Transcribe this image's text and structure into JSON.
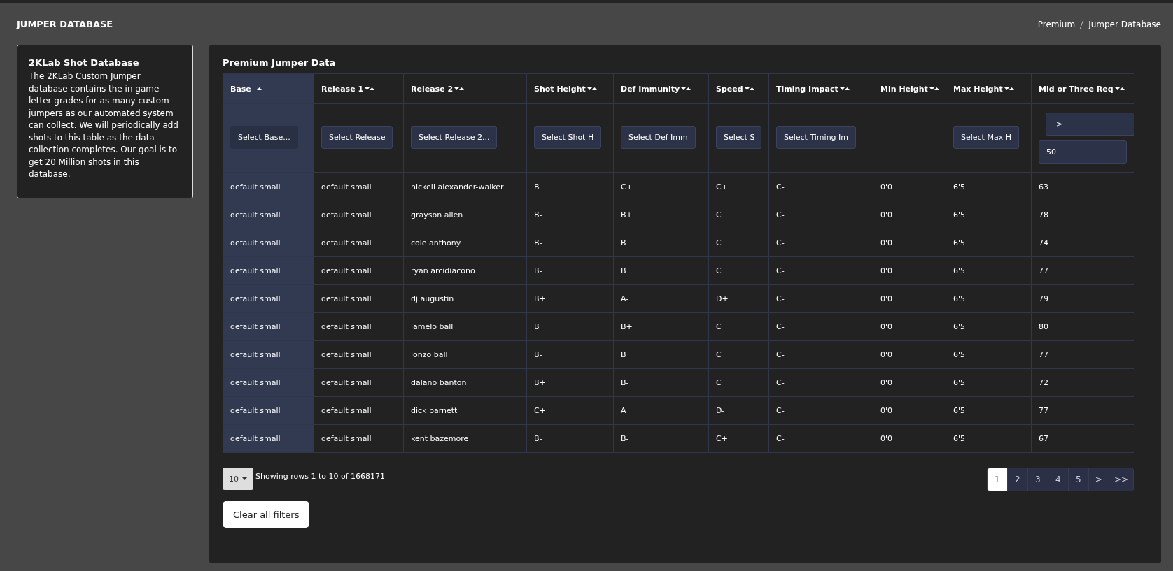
{
  "page_title": "JUMPER DATABASE",
  "breadcrumb": [
    "Premium",
    "Jumper Database"
  ],
  "info_card": {
    "title": "2KLab Shot Database",
    "text": "The 2KLab Custom Jumper database contains the in game letter grades for as many custom jumpers as our automated system can collect. We will periodically add shots to this table as the data collection completes. Our goal is to get 20 Million shots in this database."
  },
  "panel": {
    "title": "Premium Jumper Data"
  },
  "table": {
    "columns": [
      {
        "label": "Base",
        "sorted": true,
        "filter": {
          "kind": "select",
          "placeholder": "Select Base..."
        }
      },
      {
        "label": "Release 1",
        "sorted": false,
        "filter": {
          "kind": "select",
          "placeholder": "Select Release"
        }
      },
      {
        "label": "Release 2",
        "sorted": false,
        "filter": {
          "kind": "select",
          "placeholder": "Select Release 2..."
        }
      },
      {
        "label": "Shot Height",
        "sorted": false,
        "filter": {
          "kind": "select",
          "placeholder": "Select Shot H"
        }
      },
      {
        "label": "Def Immunity",
        "sorted": false,
        "filter": {
          "kind": "select",
          "placeholder": "Select Def Imm"
        }
      },
      {
        "label": "Speed",
        "sorted": false,
        "filter": {
          "kind": "select",
          "placeholder": "Select S"
        }
      },
      {
        "label": "Timing Impact",
        "sorted": false,
        "filter": {
          "kind": "select",
          "placeholder": "Select Timing Im"
        }
      },
      {
        "label": "Min Height",
        "sorted": false,
        "filter": {
          "kind": "none"
        }
      },
      {
        "label": "Max Height",
        "sorted": false,
        "filter": {
          "kind": "select",
          "placeholder": "Select Max H"
        }
      },
      {
        "label": "Mid or Three Req",
        "sorted": false,
        "filter": {
          "kind": "compare",
          "operator": ">",
          "value": "50"
        }
      }
    ],
    "rows": [
      [
        "default small",
        "default small",
        "nickeil alexander-walker",
        "B",
        "C+",
        "C+",
        "C-",
        "0'0",
        "6'5",
        "63"
      ],
      [
        "default small",
        "default small",
        "grayson allen",
        "B-",
        "B+",
        "C",
        "C-",
        "0'0",
        "6'5",
        "78"
      ],
      [
        "default small",
        "default small",
        "cole anthony",
        "B-",
        "B",
        "C",
        "C-",
        "0'0",
        "6'5",
        "74"
      ],
      [
        "default small",
        "default small",
        "ryan arcidiacono",
        "B-",
        "B",
        "C",
        "C-",
        "0'0",
        "6'5",
        "77"
      ],
      [
        "default small",
        "default small",
        "dj augustin",
        "B+",
        "A-",
        "D+",
        "C-",
        "0'0",
        "6'5",
        "79"
      ],
      [
        "default small",
        "default small",
        "lamelo ball",
        "B",
        "B+",
        "C",
        "C-",
        "0'0",
        "6'5",
        "80"
      ],
      [
        "default small",
        "default small",
        "lonzo ball",
        "B-",
        "B",
        "C",
        "C-",
        "0'0",
        "6'5",
        "77"
      ],
      [
        "default small",
        "default small",
        "dalano banton",
        "B+",
        "B-",
        "C",
        "C-",
        "0'0",
        "6'5",
        "72"
      ],
      [
        "default small",
        "default small",
        "dick barnett",
        "C+",
        "A",
        "D-",
        "C-",
        "0'0",
        "6'5",
        "77"
      ],
      [
        "default small",
        "default small",
        "kent bazemore",
        "B-",
        "B-",
        "C+",
        "C-",
        "0'0",
        "6'5",
        "67"
      ]
    ]
  },
  "page_size": "10",
  "summary": "Showing rows 1 to 10 of 1668171",
  "pagination": [
    {
      "label": "1",
      "selected": true
    },
    {
      "label": "2",
      "selected": false
    },
    {
      "label": "3",
      "selected": false
    },
    {
      "label": "4",
      "selected": false
    },
    {
      "label": "5",
      "selected": false
    },
    {
      "label": ">",
      "selected": false
    },
    {
      "label": ">>",
      "selected": false
    }
  ],
  "clear_button": "Clear all filters"
}
